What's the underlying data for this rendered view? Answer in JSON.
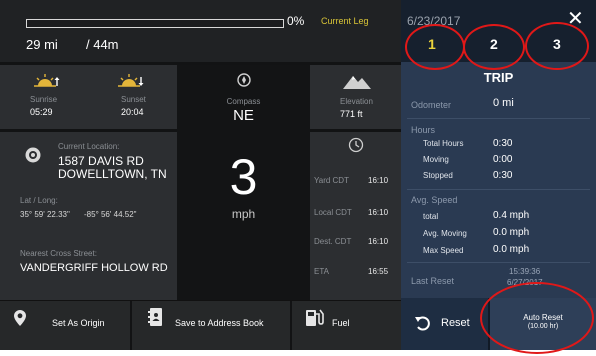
{
  "progress": {
    "percent": 0,
    "percent_label": "0%",
    "leg_label": "Current Leg",
    "distance": "29 mi",
    "time": "/ 44m"
  },
  "sun": {
    "sunrise_label": "Sunrise",
    "sunrise_time": "05:29",
    "sunset_label": "Sunset",
    "sunset_time": "20:04"
  },
  "compass": {
    "label": "Compass",
    "value": "NE"
  },
  "elevation": {
    "label": "Elevation",
    "value": "771 ft"
  },
  "location": {
    "label": "Current Location:",
    "line1": "1587 DAVIS RD",
    "line2": "DOWELLTOWN, TN",
    "latlong_label": "Lat / Long:",
    "lat": "35° 59' 22.33\"",
    "long": "-85° 56' 44.52\"",
    "cross_label": "Nearest Cross Street:",
    "cross_street": "VANDERGRIFF HOLLOW RD"
  },
  "speed": {
    "value": "3",
    "unit": "mph"
  },
  "times": [
    {
      "label": "Yard CDT",
      "value": "16:10"
    },
    {
      "label": "Local CDT",
      "value": "16:10"
    },
    {
      "label": "Dest. CDT",
      "value": "16:10"
    },
    {
      "label": "ETA",
      "value": "16:55"
    }
  ],
  "bottom": {
    "origin_label": "Set As Origin",
    "address_label": "Save to Address Book",
    "fuel_label": "Fuel"
  },
  "trip": {
    "date": "6/23/2017",
    "tabs": [
      "1",
      "2",
      "3"
    ],
    "title": "TRIP",
    "odometer_label": "Odometer",
    "odometer_value": "0 mi",
    "hours_label": "Hours",
    "total_hours_label": "Total Hours",
    "total_hours_value": "0:30",
    "moving_label": "Moving",
    "moving_value": "0:00",
    "stopped_label": "Stopped",
    "stopped_value": "0:30",
    "avg_speed_label": "Avg. Speed",
    "total_label": "total",
    "total_value": "0.4 mph",
    "avg_moving_label": "Avg. Moving",
    "avg_moving_value": "0.0 mph",
    "max_speed_label": "Max Speed",
    "max_speed_value": "0.0 mph",
    "last_reset_label": "Last Reset",
    "last_reset_time": "15:39:36",
    "last_reset_date": "6/27/2017",
    "reset_label": "Reset",
    "auto_reset_label": "Auto Reset",
    "auto_reset_sub": "(10.00 hr)"
  },
  "colors": {
    "accent": "#e9d23c",
    "annotation": "#e01818"
  }
}
